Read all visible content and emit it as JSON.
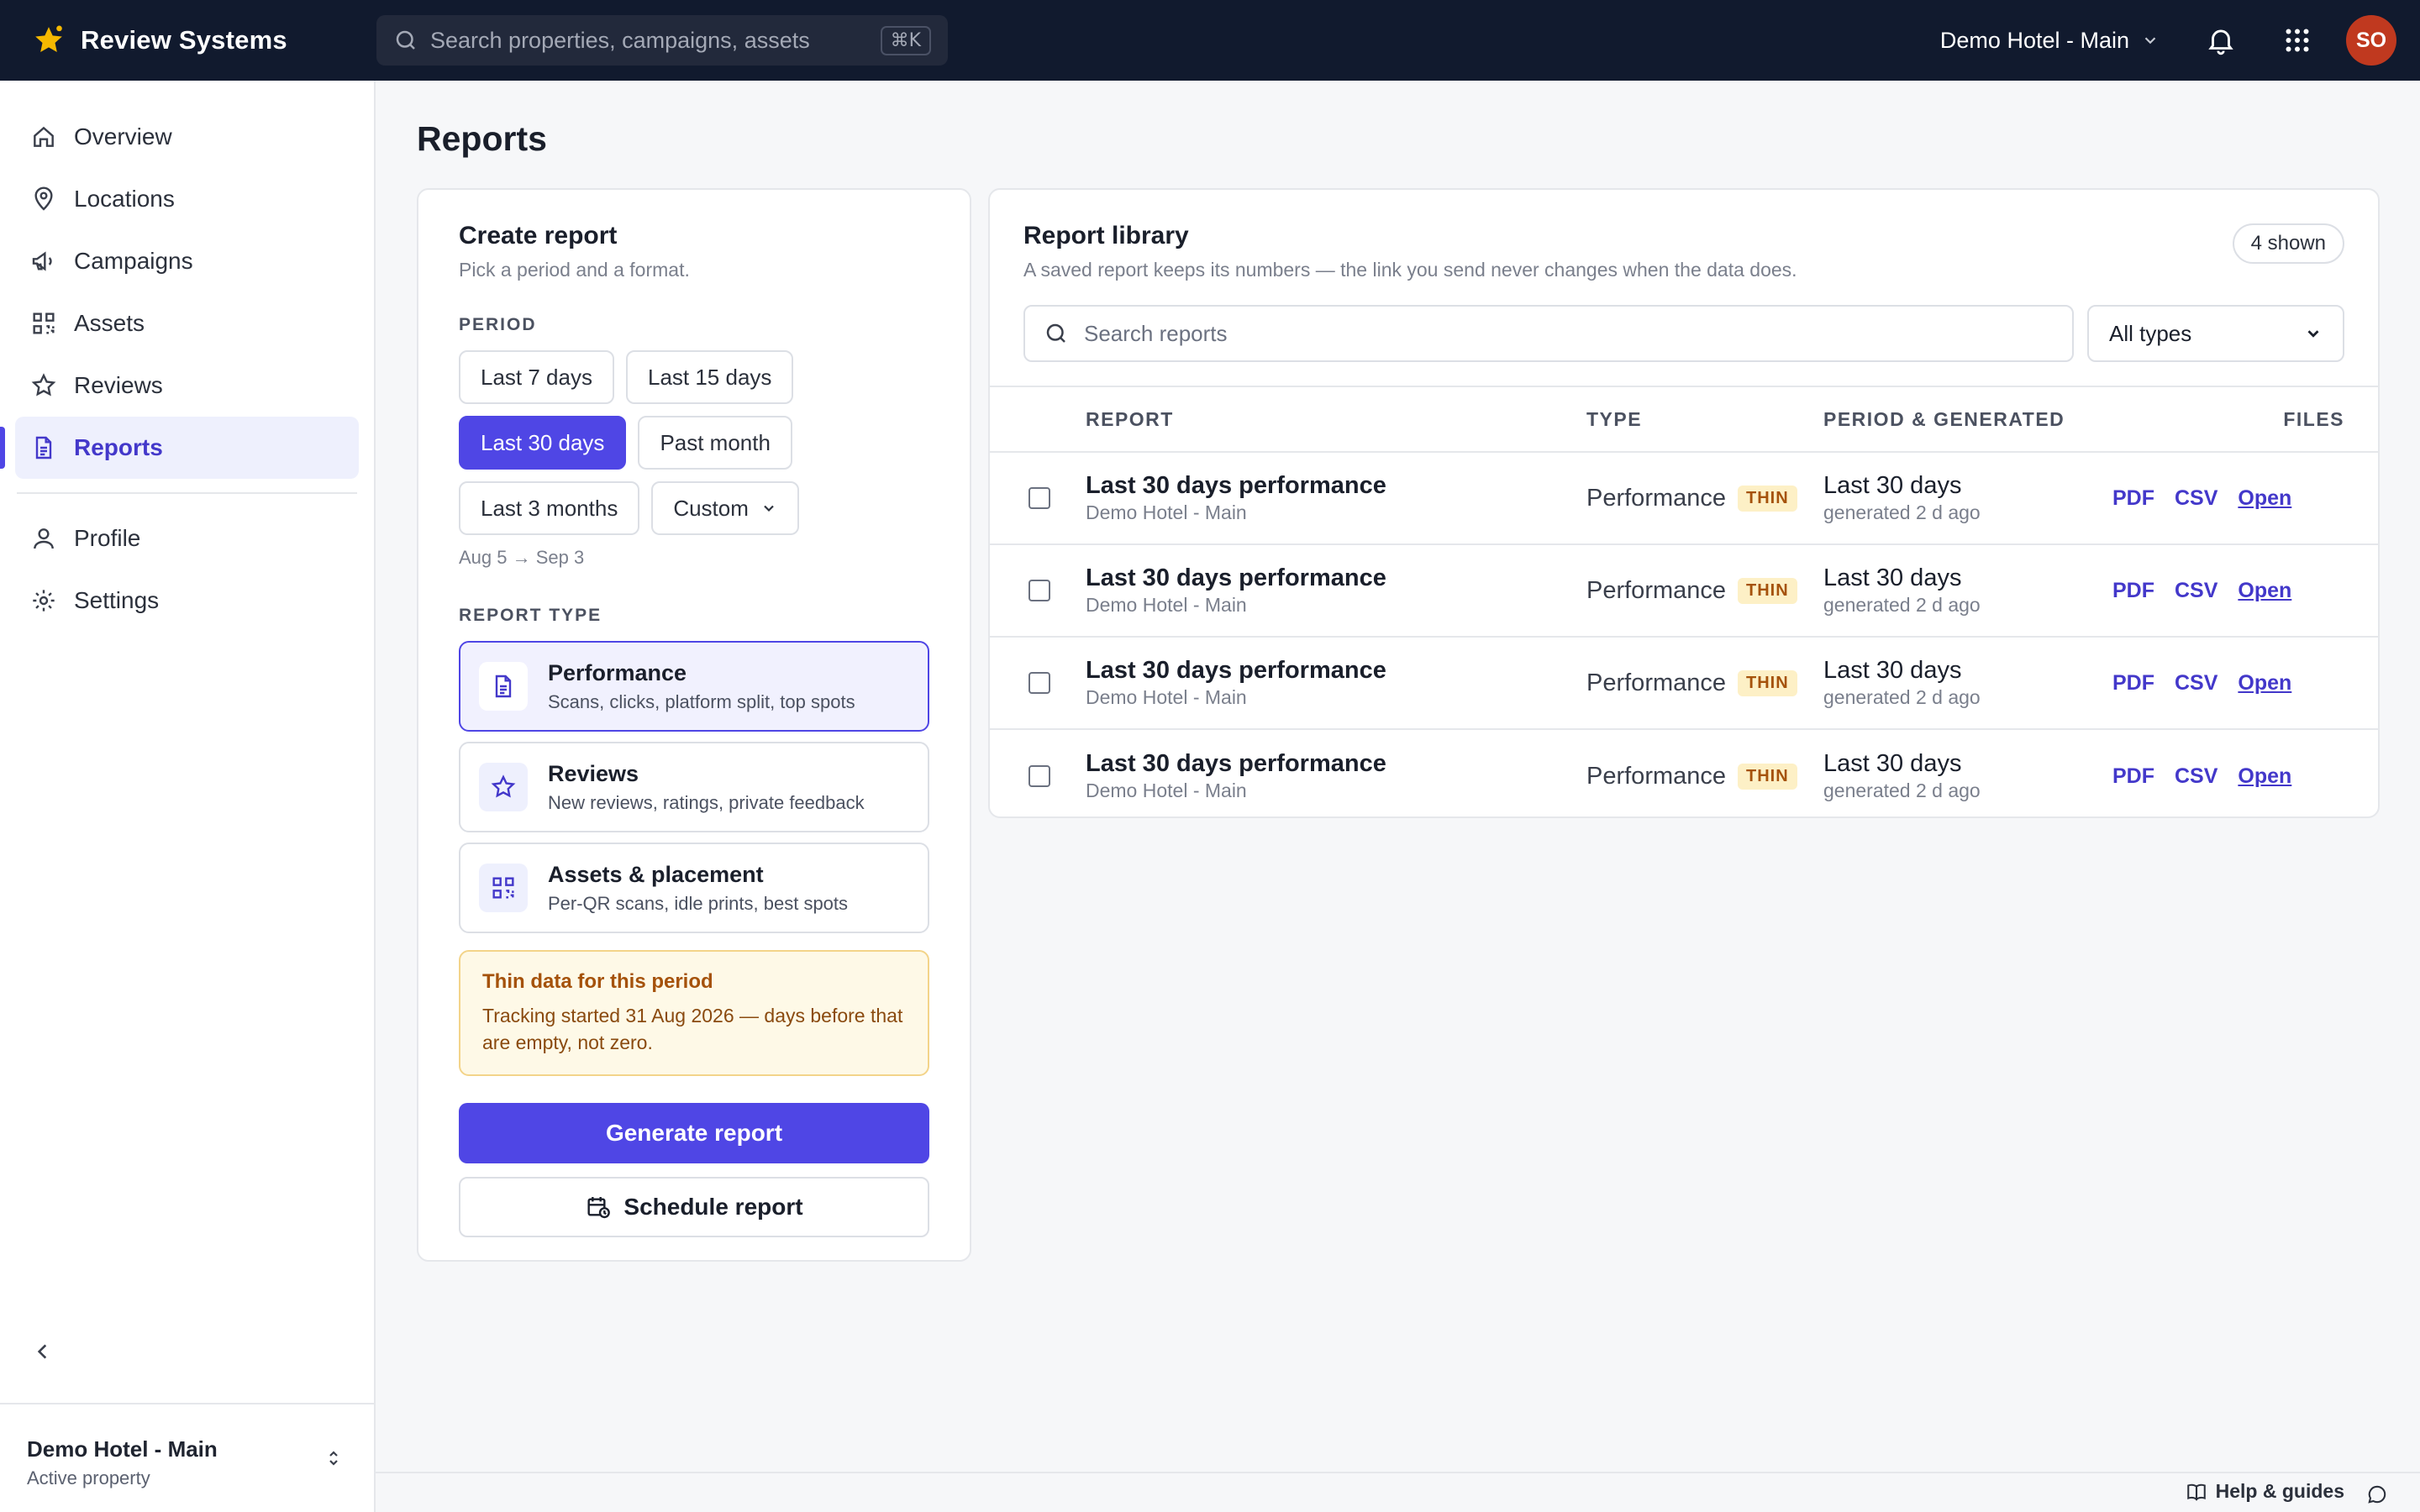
{
  "app": {
    "name": "Review Systems",
    "search_placeholder": "Search properties, campaigns, assets",
    "search_shortcut": "⌘K",
    "property": "Demo Hotel - Main",
    "avatar_initials": "SO",
    "brand_color": "#111a2e",
    "accent_color": "#4f46e5"
  },
  "sidebar": {
    "items": [
      {
        "label": "Overview",
        "icon": "home-icon"
      },
      {
        "label": "Locations",
        "icon": "map-pin-icon"
      },
      {
        "label": "Campaigns",
        "icon": "megaphone-icon"
      },
      {
        "label": "Assets",
        "icon": "qr-code-icon"
      },
      {
        "label": "Reviews",
        "icon": "star-icon"
      },
      {
        "label": "Reports",
        "icon": "document-icon",
        "active": true
      }
    ],
    "secondary": [
      {
        "label": "Profile",
        "icon": "user-icon"
      },
      {
        "label": "Settings",
        "icon": "gear-icon"
      }
    ],
    "footer": {
      "title": "Demo Hotel - Main",
      "subtitle": "Active property"
    }
  },
  "page": {
    "title": "Reports"
  },
  "create": {
    "title": "Create report",
    "subtitle": "Pick a period and a format.",
    "period_label": "PERIOD",
    "periods": [
      "Last 7 days",
      "Last 15 days",
      "Last 30 days",
      "Past month",
      "Last 3 months",
      "Custom"
    ],
    "selected_period": "Last 30 days",
    "date_range": "Aug 5 → Sep 3",
    "type_label": "REPORT TYPE",
    "types": [
      {
        "title": "Performance",
        "desc": "Scans, clicks, platform split, top spots",
        "icon": "document-icon",
        "selected": true
      },
      {
        "title": "Reviews",
        "desc": "New reviews, ratings, private feedback",
        "icon": "star-icon"
      },
      {
        "title": "Assets & placement",
        "desc": "Per-QR scans, idle prints, best spots",
        "icon": "qr-code-icon"
      }
    ],
    "warning": {
      "title": "Thin data for this period",
      "body": "Tracking started 31 Aug 2026 — days before that are empty, not zero."
    },
    "generate_label": "Generate report",
    "schedule_label": "Schedule report"
  },
  "library": {
    "title": "Report library",
    "subtitle": "A saved report keeps its numbers — the link you send never changes when the data does.",
    "shown": "4 shown",
    "search_placeholder": "Search reports",
    "type_filter": "All types",
    "columns": {
      "report": "REPORT",
      "type": "TYPE",
      "period": "PERIOD & GENERATED",
      "files": "FILES"
    },
    "rows": [
      {
        "title": "Last 30 days performance",
        "property": "Demo Hotel - Main",
        "type": "Performance",
        "badge": "THIN",
        "period": "Last 30 days",
        "generated": "generated 2 d ago",
        "pdf": "PDF",
        "csv": "CSV",
        "open": "Open"
      },
      {
        "title": "Last 30 days performance",
        "property": "Demo Hotel - Main",
        "type": "Performance",
        "badge": "THIN",
        "period": "Last 30 days",
        "generated": "generated 2 d ago",
        "pdf": "PDF",
        "csv": "CSV",
        "open": "Open"
      },
      {
        "title": "Last 30 days performance",
        "property": "Demo Hotel - Main",
        "type": "Performance",
        "badge": "THIN",
        "period": "Last 30 days",
        "generated": "generated 2 d ago",
        "pdf": "PDF",
        "csv": "CSV",
        "open": "Open"
      },
      {
        "title": "Last 30 days performance",
        "property": "Demo Hotel - Main",
        "type": "Performance",
        "badge": "THIN",
        "period": "Last 30 days",
        "generated": "generated 2 d ago",
        "pdf": "PDF",
        "csv": "CSV",
        "open": "Open"
      }
    ]
  },
  "footer": {
    "help": "Help & guides"
  }
}
